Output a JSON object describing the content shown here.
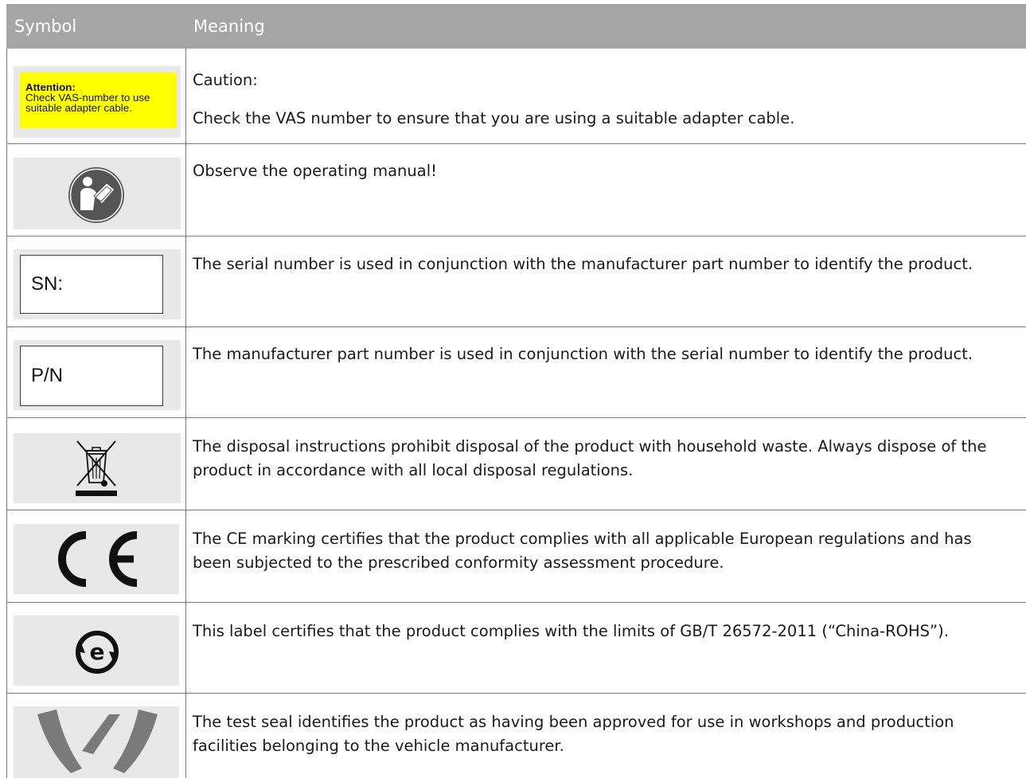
{
  "header": {
    "symbol": "Symbol",
    "meaning": "Meaning"
  },
  "rows": [
    {
      "symbol_label": {
        "line1": "Attention:",
        "line2": "Check VAS-number to use",
        "line3": "suitable adapter cable."
      },
      "meaning_line1": "Caution:",
      "meaning_line2": "Check the VAS number to ensure that you are using a suitable adapter cable.",
      "icon": "attention-label"
    },
    {
      "meaning": "Observe the operating manual!",
      "icon": "operating-manual-icon"
    },
    {
      "symbol_text": "SN:",
      "meaning": "The serial number is used in conjunction with the manufacturer part number to identify the product.",
      "icon": "serial-number-label"
    },
    {
      "symbol_text": "P/N",
      "meaning": "The manufacturer part number is used in conjunction with the serial number to identify the product.",
      "icon": "part-number-label"
    },
    {
      "meaning": "The disposal instructions prohibit disposal of the product with household waste. Always dispose of the product in accordance with all local disposal regulations.",
      "icon": "crossed-out-bin-icon"
    },
    {
      "meaning": "The CE marking certifies that the product complies with all applicable European regulations and has been subjected to the prescribed conformity assessment procedure.",
      "icon": "ce-mark-icon"
    },
    {
      "meaning": "This label certifies that the product complies with the limits of GB/T 26572-2011 (“China-ROHS”).",
      "icon": "china-rohs-icon"
    },
    {
      "meaning": "The test seal identifies the product as having been approved for use in workshops and production facilities belonging to the vehicle manufacturer.",
      "icon": "test-seal-icon"
    }
  ],
  "colors": {
    "header_bg": "#a5a5a5",
    "symbol_bg": "#e8e8e8",
    "attention_bg": "#ffff00",
    "border": "#7a7a7a"
  }
}
